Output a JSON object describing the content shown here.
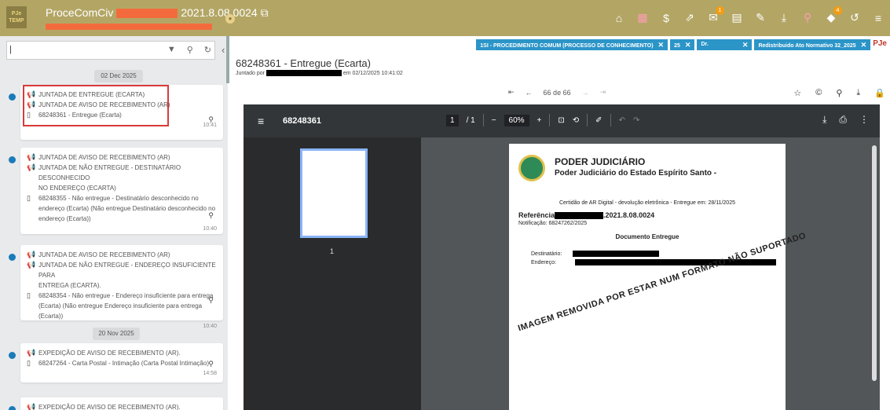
{
  "topbar": {
    "logo_top": "PJe",
    "logo_bottom": "TEMP",
    "process_prefix": "ProceComCiv",
    "process_number": "2021.8.08.0024",
    "copy_icon": "copy-icon",
    "icons": [
      "home-icon",
      "calendar-icon",
      "dollar-icon",
      "external-link-icon",
      "mail-icon",
      "document-icon",
      "edit-icon",
      "download-icon",
      "pin-icon",
      "tag-icon",
      "history-icon",
      "menu-icon"
    ],
    "mail_badge": "1",
    "tag_badge": "4"
  },
  "left_panel": {
    "search_value": "|",
    "groups": [
      {
        "date": "02 Dec 2025"
      },
      {
        "date": "20 Nov 2025"
      }
    ],
    "cards": [
      {
        "lines": [
          "JUNTADA DE ENTREGUE (ECARTA)",
          "JUNTADA DE AVISO DE RECEBIMENTO (AR)"
        ],
        "doc": "68248361 - Entregue (Ecarta)",
        "time": "10:41"
      },
      {
        "lines": [
          "JUNTADA DE AVISO DE RECEBIMENTO (AR)",
          "JUNTADA DE NÃO ENTREGUE - DESTINATÁRIO DESCONHECIDO",
          "NO ENDEREÇO (ECARTA)"
        ],
        "doc": "68248355 - Não entregue - Destinatário desconhecido no endereço (Ecarta) (Não entregue Destinatário desconhecido no endereço (Ecarta))",
        "time": "10:40"
      },
      {
        "lines": [
          "JUNTADA DE AVISO DE RECEBIMENTO (AR)",
          "JUNTADA DE NÃO ENTREGUE - ENDEREÇO INSUFICIENTE PARA",
          "ENTREGA (ECARTA)."
        ],
        "doc": "68248354 - Não entregue - Endereço insuficiente para entrega (Ecarta) (Não entregue Endereço insuficiente para entrega (Ecarta))",
        "time": "10:40"
      },
      {
        "lines": [
          "EXPEDIÇÃO DE AVISO DE RECEBIMENTO (AR)."
        ],
        "doc": "68247264 - Carta Postal - Intimação (Carta Postal Intimação)",
        "time": "14:58"
      },
      {
        "lines": [
          "EXPEDIÇÃO DE AVISO DE RECEBIMENTO (AR)."
        ],
        "doc": "",
        "time": ""
      }
    ]
  },
  "tags": [
    {
      "label": "1SI - PROCEDIMENTO COMUM (PROCESSO DE CONHECIMENTO)"
    },
    {
      "label": "25"
    },
    {
      "label": "Dr."
    },
    {
      "label": "Redistribuido Ato Normativo 32_2025"
    }
  ],
  "document": {
    "title": "68248361 - Entregue (Ecarta)",
    "juntado_prefix": "Juntado por",
    "juntado_suffix": "em 02/12/2025 10:41:02",
    "page_label": "66 de 66"
  },
  "viewer": {
    "name": "68248361",
    "page_current": "1",
    "page_total": "/ 1",
    "zoom": "60%",
    "thumb_number": "1",
    "page": {
      "org1": "PODER JUDICIÁRIO",
      "org2": "Poder Judiciário do Estado Espírito Santo -",
      "certidao": "Certidão de AR Digital - devolução eletrônica - Entregue em: 28/11/2025",
      "ref_label": "Referência",
      "ref_number": ".2021.8.08.0024",
      "notificacao": "Notificação:  68247262/2025",
      "doc_heading": "Documento Entregue",
      "destinatario": "Destinatário:",
      "endereco": "Endereço:",
      "watermark": "IMAGEM REMOVIDA POR ESTAR NUM FORMATO NÃO SUPORTADO"
    }
  }
}
